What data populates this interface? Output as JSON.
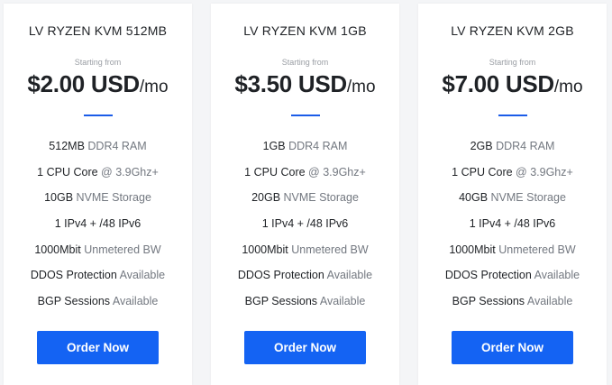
{
  "plans": [
    {
      "title": "LV RYZEN KVM 512MB",
      "starting_label": "Starting from",
      "price": "$2.00 USD",
      "period": "/mo",
      "features": [
        {
          "main": "512MB",
          "sub": "DDR4 RAM"
        },
        {
          "main": "1 CPU Core",
          "sub": "@ 3.9Ghz+"
        },
        {
          "main": "10GB",
          "sub": "NVME Storage"
        },
        {
          "main": "1 IPv4 + /48 IPv6",
          "sub": ""
        },
        {
          "main": "1000Mbit",
          "sub": "Unmetered BW"
        },
        {
          "main": "DDOS Protection",
          "sub": "Available"
        },
        {
          "main": "BGP Sessions",
          "sub": "Available"
        }
      ],
      "button_label": "Order Now"
    },
    {
      "title": "LV RYZEN KVM 1GB",
      "starting_label": "Starting from",
      "price": "$3.50 USD",
      "period": "/mo",
      "features": [
        {
          "main": "1GB",
          "sub": "DDR4 RAM"
        },
        {
          "main": "1 CPU Core",
          "sub": "@ 3.9Ghz+"
        },
        {
          "main": "20GB",
          "sub": "NVME Storage"
        },
        {
          "main": "1 IPv4 + /48 IPv6",
          "sub": ""
        },
        {
          "main": "1000Mbit",
          "sub": "Unmetered BW"
        },
        {
          "main": "DDOS Protection",
          "sub": "Available"
        },
        {
          "main": "BGP Sessions",
          "sub": "Available"
        }
      ],
      "button_label": "Order Now"
    },
    {
      "title": "LV RYZEN KVM 2GB",
      "starting_label": "Starting from",
      "price": "$7.00 USD",
      "period": "/mo",
      "features": [
        {
          "main": "2GB",
          "sub": "DDR4 RAM"
        },
        {
          "main": "1 CPU Core",
          "sub": "@ 3.9Ghz+"
        },
        {
          "main": "40GB",
          "sub": "NVME Storage"
        },
        {
          "main": "1 IPv4 + /48 IPv6",
          "sub": ""
        },
        {
          "main": "1000Mbit",
          "sub": "Unmetered BW"
        },
        {
          "main": "DDOS Protection",
          "sub": "Available"
        },
        {
          "main": "BGP Sessions",
          "sub": "Available"
        }
      ],
      "button_label": "Order Now"
    }
  ],
  "colors": {
    "accent": "#1463f3",
    "divider": "#1b5ce8",
    "background": "#f4f5f7",
    "card": "#ffffff"
  }
}
